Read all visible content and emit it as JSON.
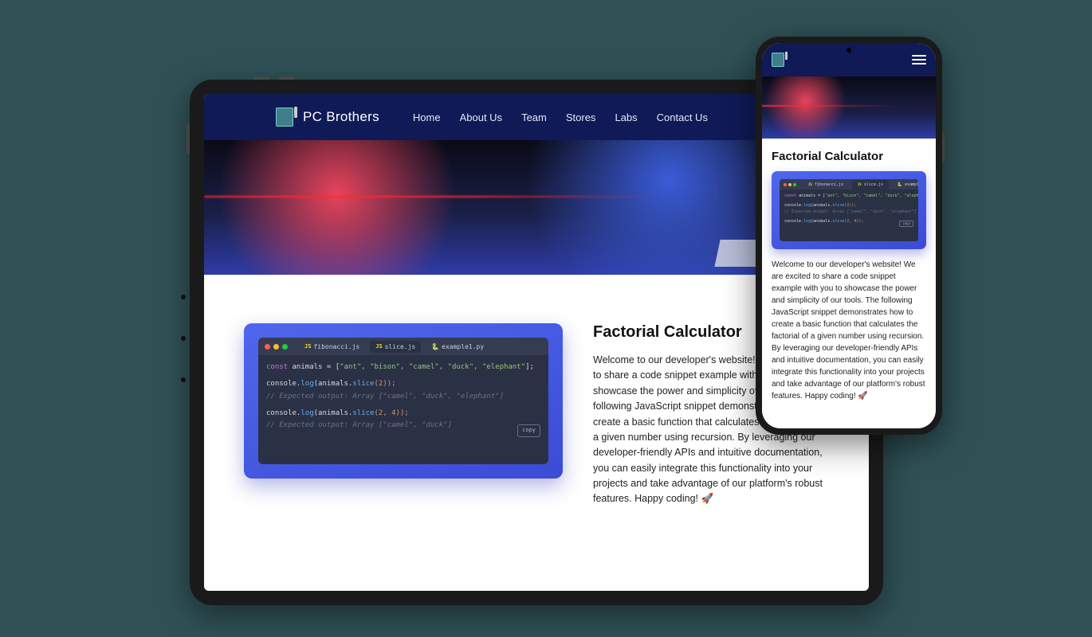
{
  "site": {
    "title": "PC Brothers",
    "nav": [
      "Home",
      "About Us",
      "Team",
      "Stores",
      "Labs",
      "Contact Us"
    ]
  },
  "article": {
    "heading": "Factorial Calculator",
    "body": "Welcome to our developer's website! We are excited to share a code snippet example with you to showcase the power and simplicity of our tools. The following JavaScript snippet demonstrates how to create a basic function that calculates the factorial of a given number using recursion. By leveraging our developer-friendly APIs and intuitive documentation, you can easily integrate this functionality into your projects and take advantage of our platform's robust features. Happy coding! 🚀"
  },
  "editor": {
    "tabs": [
      {
        "label": "fibonacci.js",
        "lang": "JS",
        "active": false
      },
      {
        "label": "slice.js",
        "lang": "JS",
        "active": true
      },
      {
        "label": "example1.py",
        "lang": "🐍",
        "active": false
      }
    ],
    "copy_label": "copy",
    "code": {
      "l1_kw": "const",
      "l1_var": "animals",
      "l1_eq": "= [",
      "l1_items": "\"ant\", \"bison\", \"camel\", \"duck\", \"elephant\"",
      "l1_end": "];",
      "l2_pre": "console.",
      "l2_fn": "log",
      "l2_mid": "(animals.",
      "l2_fn2": "slice",
      "l2_arg": "(2));",
      "l3_comment": "// Expected output: Array [\"camel\", \"duck\", \"elephant\"]",
      "l4_pre": "console.",
      "l4_fn": "log",
      "l4_mid": "(animals.",
      "l4_fn2": "slice",
      "l4_arg": "(2, 4));",
      "l5_comment": "// Expected output: Array [\"camel\", \"duck\"]"
    }
  }
}
